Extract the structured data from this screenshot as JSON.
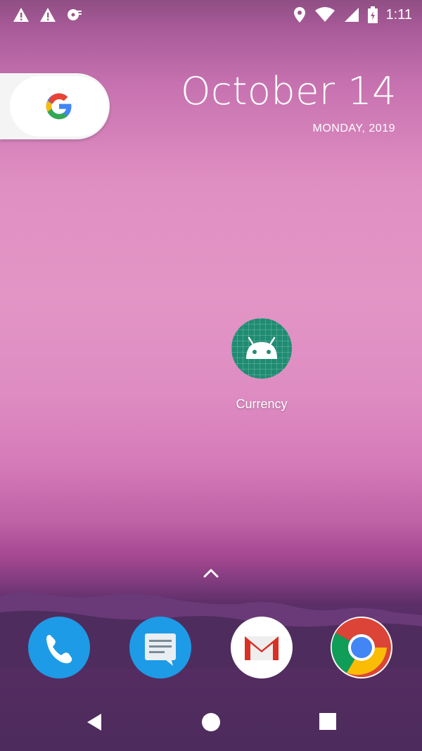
{
  "status_bar": {
    "time": "1:11",
    "left_icons": [
      "warning-icon",
      "warning-icon",
      "disc-icon"
    ],
    "right_icons": [
      "location-icon",
      "wifi-icon",
      "signal-icon",
      "battery-icon"
    ]
  },
  "date_widget": {
    "date": "October 14",
    "day_year": "MONDAY, 2019"
  },
  "search_widget": {
    "icon": "google-g-icon"
  },
  "home_apps": [
    {
      "label": "Currency",
      "icon": "android-icon",
      "color": "#1f8c72"
    }
  ],
  "dock": [
    {
      "name": "phone",
      "icon": "phone-icon",
      "color": "#1e9be6"
    },
    {
      "name": "messages",
      "icon": "messages-icon",
      "color": "#1e9be6"
    },
    {
      "name": "gmail",
      "icon": "gmail-icon",
      "color": "#ffffff"
    },
    {
      "name": "chrome",
      "icon": "chrome-icon",
      "color": "#ffffff"
    }
  ],
  "nav": [
    "back-icon",
    "home-icon",
    "recents-icon"
  ]
}
